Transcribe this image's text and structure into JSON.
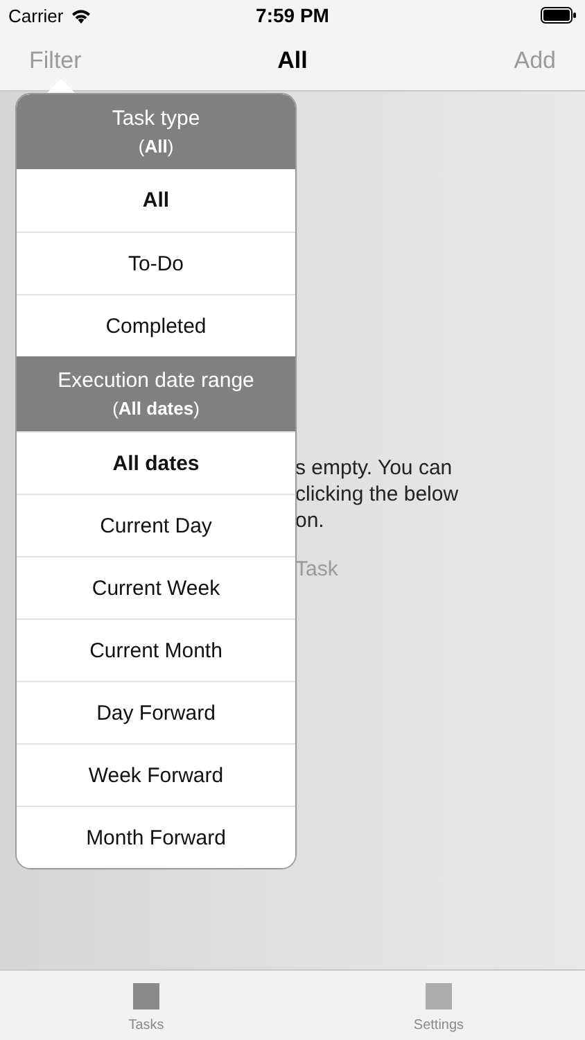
{
  "status_bar": {
    "carrier": "Carrier",
    "time": "7:59 PM"
  },
  "nav_bar": {
    "left": "Filter",
    "title": "All",
    "right": "Add"
  },
  "empty_message": {
    "lines": [
      "s empty. You can",
      "clicking the below",
      "on."
    ],
    "button": "Task"
  },
  "filter_popover": {
    "sections": [
      {
        "title": "Task type",
        "current": "(**All**)",
        "options": [
          {
            "label": "All",
            "selected": true
          },
          {
            "label": "To-Do",
            "selected": false
          },
          {
            "label": "Completed",
            "selected": false
          }
        ]
      },
      {
        "title": "Execution date range",
        "current": "(**All dates**)",
        "options": [
          {
            "label": "All dates",
            "selected": true
          },
          {
            "label": "Current Day",
            "selected": false
          },
          {
            "label": "Current Week",
            "selected": false
          },
          {
            "label": "Current Month",
            "selected": false
          },
          {
            "label": "Day Forward",
            "selected": false
          },
          {
            "label": "Week Forward",
            "selected": false
          },
          {
            "label": "Month Forward",
            "selected": false
          }
        ]
      }
    ]
  },
  "tab_bar": [
    {
      "label": "Tasks",
      "selected": true
    },
    {
      "label": "Settings",
      "selected": false
    }
  ]
}
